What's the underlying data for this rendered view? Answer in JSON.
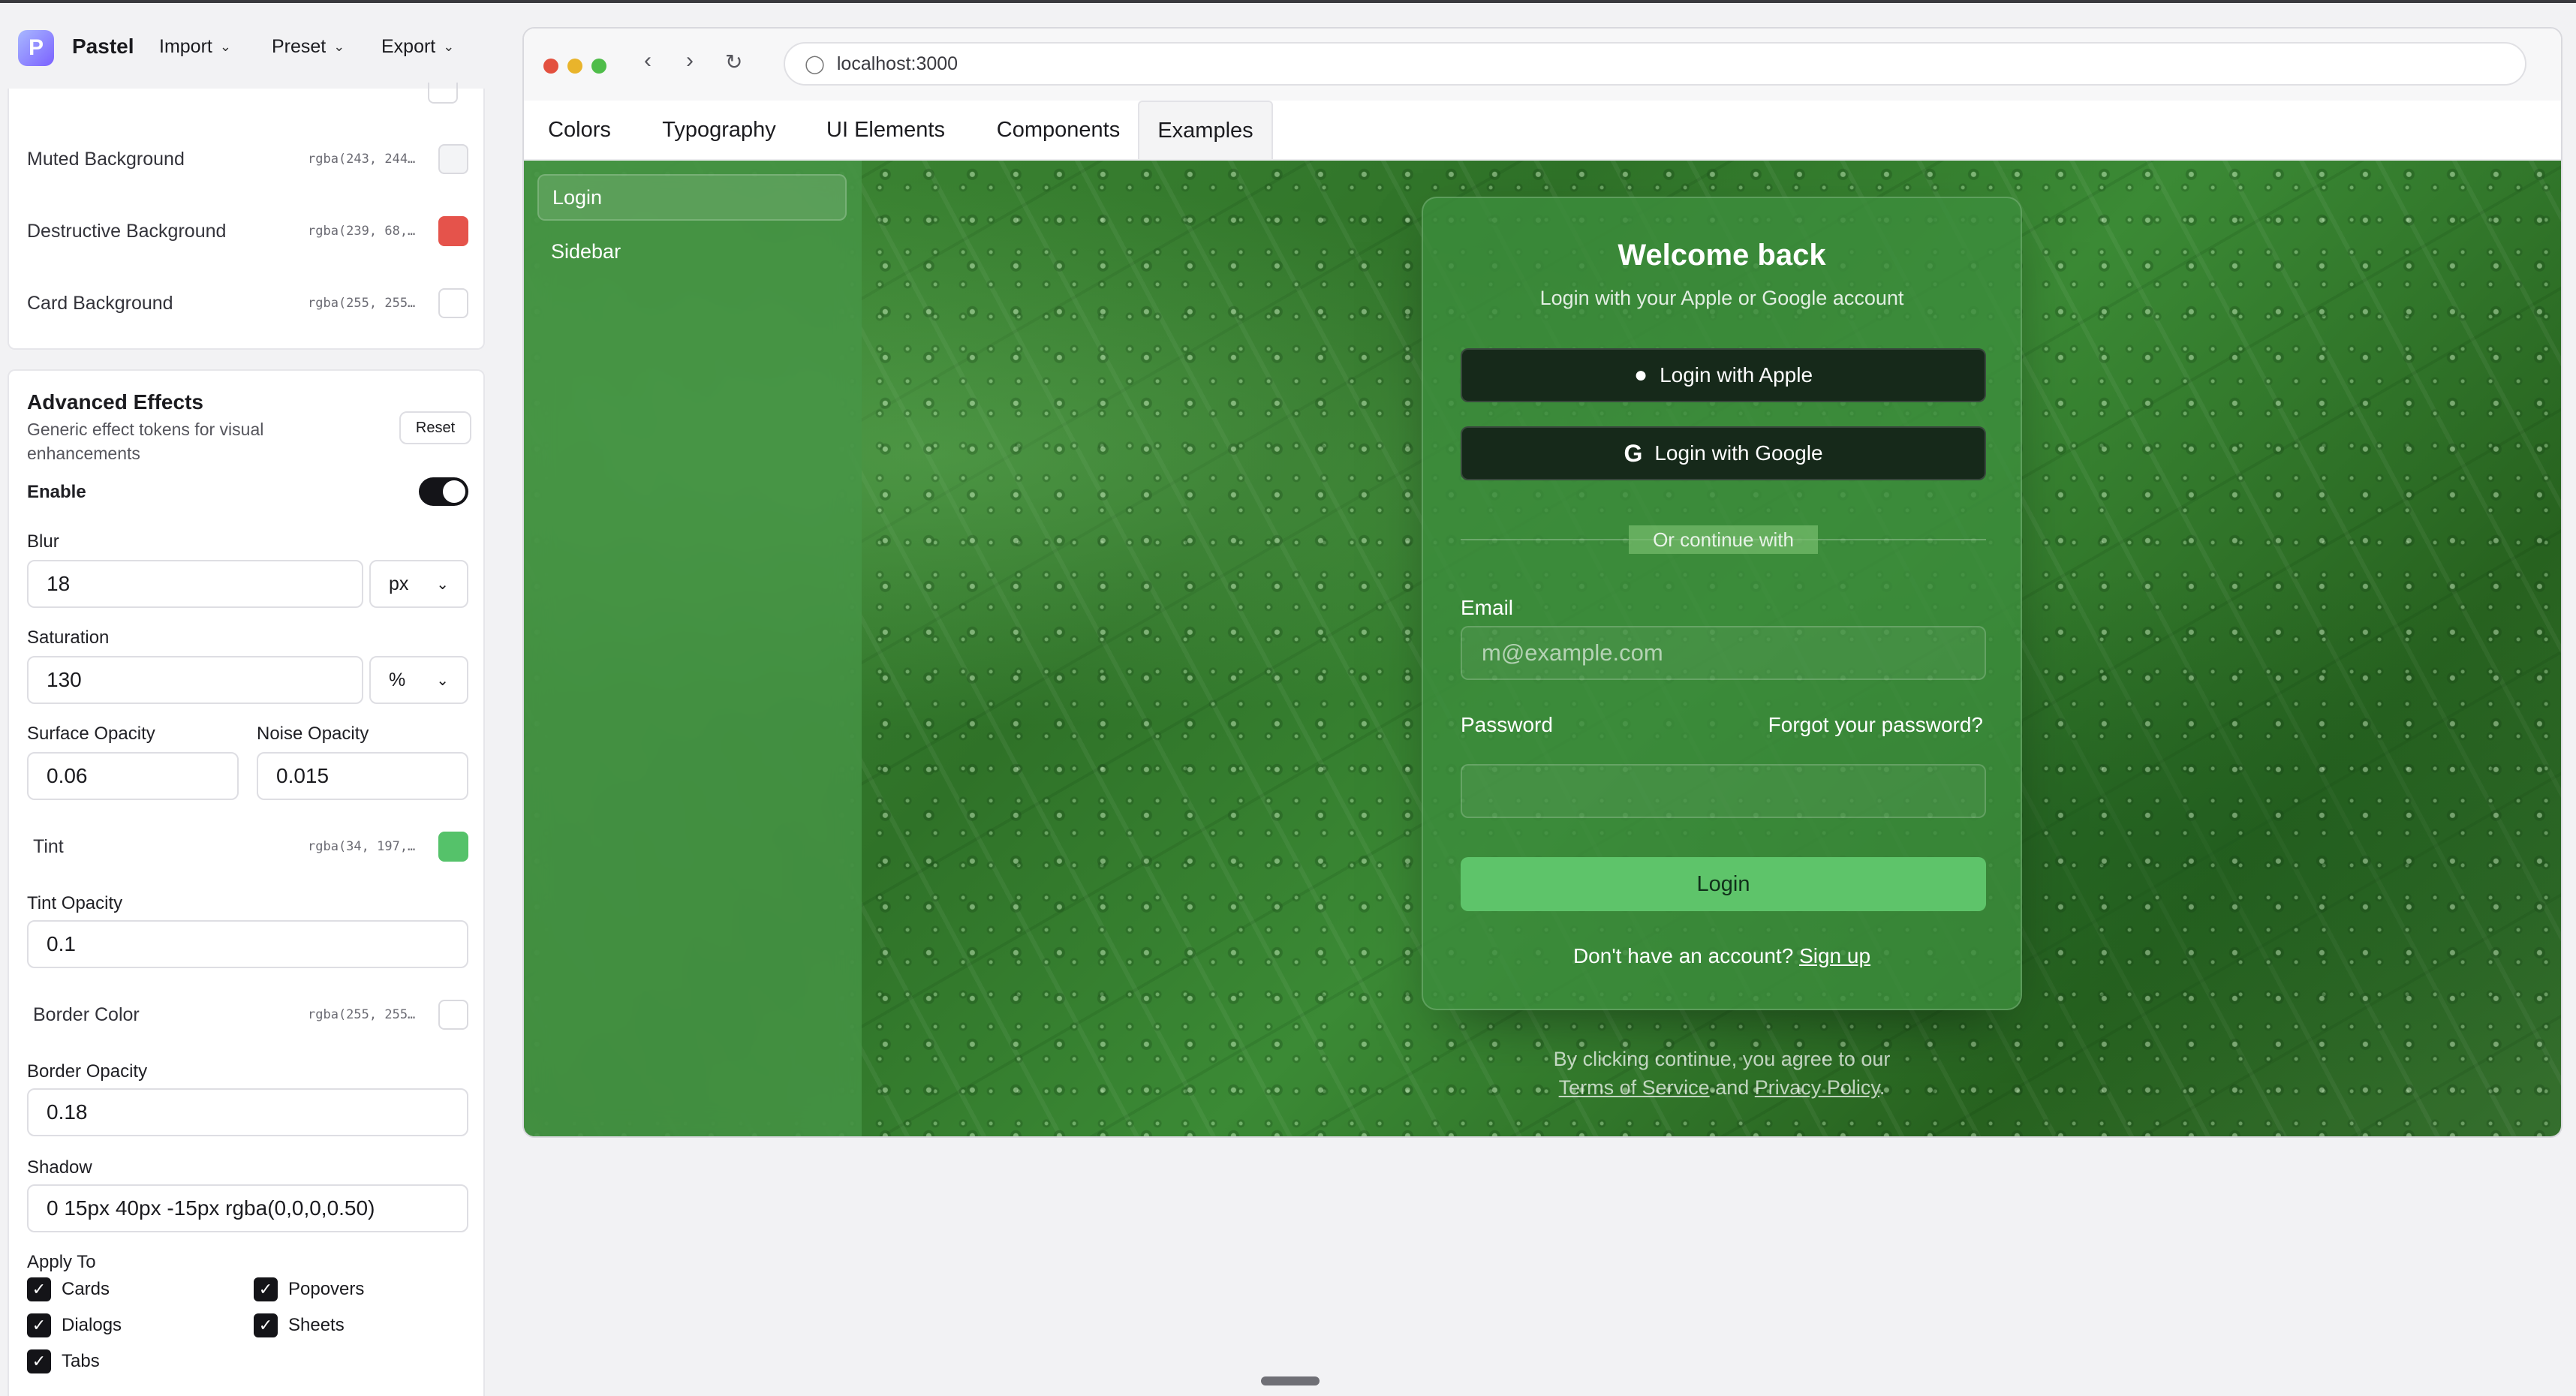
{
  "app": {
    "name": "Pastel",
    "logo_letter": "P",
    "menus": [
      "Import",
      "Preset",
      "Export"
    ]
  },
  "colors_panel": {
    "rows": [
      {
        "label": "Muted Background",
        "value": "rgba(243, 244…",
        "swatch": "#f3f4f6"
      },
      {
        "label": "Destructive Background",
        "value": "rgba(239, 68,…",
        "swatch": "#ef4444"
      },
      {
        "label": "Card Background",
        "value": "rgba(255, 255…",
        "swatch": "#ffffff"
      }
    ]
  },
  "effects": {
    "title": "Advanced Effects",
    "description": "Generic effect tokens for visual enhancements",
    "reset_label": "Reset",
    "enable_label": "Enable",
    "enabled": true,
    "blur_label": "Blur",
    "blur_value": "18",
    "blur_unit": "px",
    "saturation_label": "Saturation",
    "saturation_value": "130",
    "saturation_unit": "%",
    "surface_opacity_label": "Surface Opacity",
    "surface_opacity_value": "0.06",
    "noise_opacity_label": "Noise Opacity",
    "noise_opacity_value": "0.015",
    "tint_label": "Tint",
    "tint_value": "rgba(34, 197,…",
    "tint_color": "#55c26a",
    "tint_opacity_label": "Tint Opacity",
    "tint_opacity_value": "0.1",
    "border_color_label": "Border Color",
    "border_color_value": "rgba(255, 255…",
    "border_color_swatch": "#ffffff",
    "border_opacity_label": "Border Opacity",
    "border_opacity_value": "0.18",
    "shadow_label": "Shadow",
    "shadow_value": "0 15px 40px -15px rgba(0,0,0,0.50)",
    "apply_to_label": "Apply To",
    "apply_to": [
      "Cards",
      "Popovers",
      "Dialogs",
      "Sheets",
      "Tabs"
    ]
  },
  "browser": {
    "url": "localhost:3000",
    "tabs": [
      "Colors",
      "Typography",
      "UI Elements",
      "Components",
      "Examples"
    ],
    "active_tab": "Examples"
  },
  "example": {
    "sidebar_items": [
      "Login",
      "Sidebar"
    ],
    "active_item": "Login",
    "title": "Welcome back",
    "subtitle": "Login with your Apple or Google account",
    "apple_label": "Login with Apple",
    "google_label": "Login with Google",
    "divider_text": "Or continue with",
    "email_label": "Email",
    "email_placeholder": "m@example.com",
    "password_label": "Password",
    "forgot_label": "Forgot your password?",
    "login_label": "Login",
    "no_account_text": "Don't have an account?",
    "signup_label": "Sign up",
    "terms_prefix": "By clicking continue, you agree to our",
    "terms_link": "Terms of Service",
    "terms_and": "and",
    "privacy_link": "Privacy Policy",
    "terms_suffix": "."
  }
}
